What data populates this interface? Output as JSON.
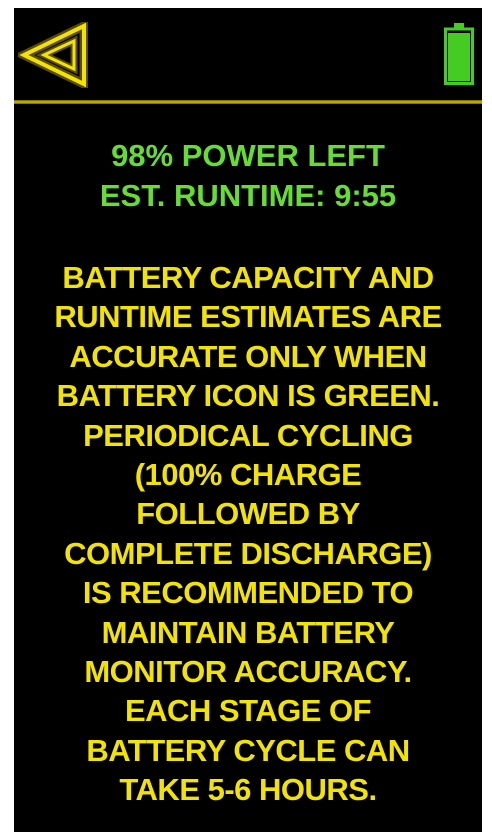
{
  "header": {
    "back_icon": "back-arrow-icon",
    "battery_icon": "battery-icon",
    "battery_level": 0.98
  },
  "status": {
    "power_left": "98% POWER LEFT",
    "runtime": "EST. RUNTIME: 9:55"
  },
  "notice": {
    "lines": [
      "BATTERY CAPACITY AND",
      "RUNTIME ESTIMATES ARE",
      "ACCURATE ONLY WHEN",
      "BATTERY ICON IS GREEN.",
      "PERIODICAL CYCLING",
      "(100% CHARGE",
      "FOLLOWED BY",
      "COMPLETE DISCHARGE)",
      "IS RECOMMENDED TO",
      "MAINTAIN BATTERY",
      "MONITOR ACCURACY.",
      "EACH STAGE OF",
      "BATTERY CYCLE CAN",
      "TAKE 5-6 HOURS."
    ]
  },
  "colors": {
    "background": "#000000",
    "accent_yellow": "#f2e400",
    "status_green": "#66dd33",
    "battery_green": "#44cc22"
  }
}
